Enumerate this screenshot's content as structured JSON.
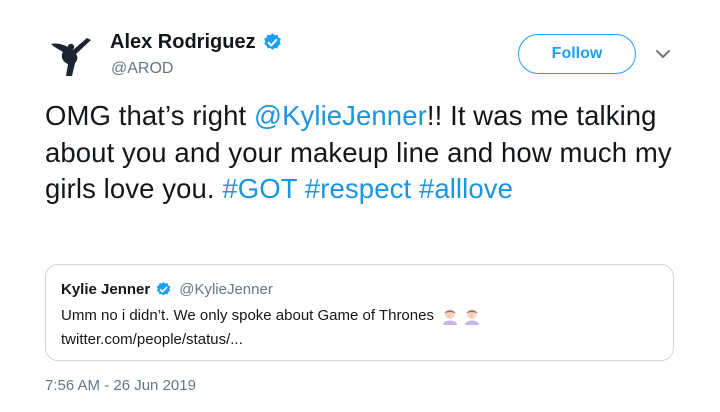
{
  "author": {
    "name": "Alex Rodriguez",
    "handle": "@AROD"
  },
  "follow_label": "Follow",
  "tweet": {
    "text_parts": {
      "p1": "OMG that’s right ",
      "mention": "@KylieJenner",
      "p2": "!! It was me talking about you and your makeup line and how much my girls love you. ",
      "tag1": "#GOT",
      "space1": " ",
      "tag2": "#respect",
      "space2": " ",
      "tag3": "#alllove"
    },
    "timestamp": "7:56 AM - 26 Jun 2019"
  },
  "quoted": {
    "name": "Kylie Jenner",
    "handle": "@KylieJenner",
    "text": "Umm no i didn’t. We only spoke about Game of Thrones",
    "url": "twitter.com/people/status/..."
  },
  "colors": {
    "link": "#1b95e0",
    "follow_accent": "#1da1f2",
    "secondary_text": "#657786",
    "border": "#ccd6dd"
  },
  "icons": [
    "logo-avatar-icon",
    "verified-badge-icon",
    "chevron-down-icon",
    "facepalm-emoji-icon"
  ]
}
